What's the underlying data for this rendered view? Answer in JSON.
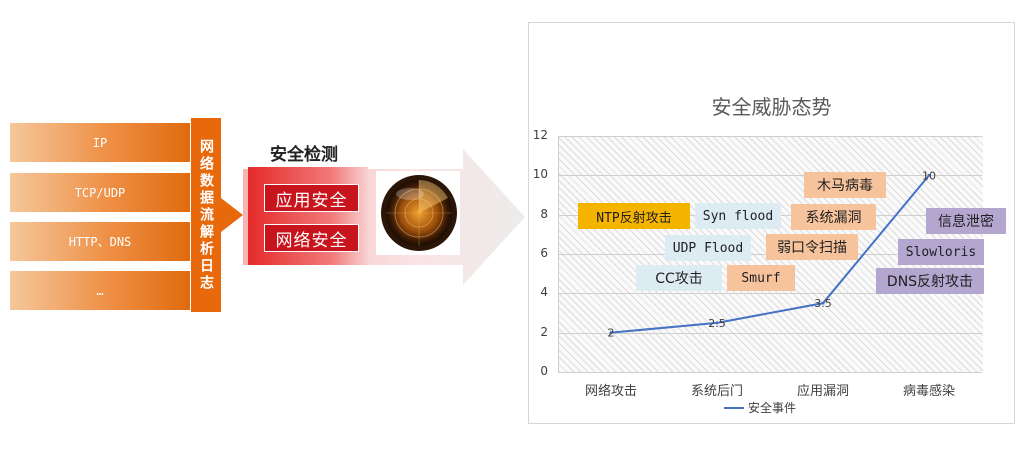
{
  "left": {
    "stack_items": [
      "IP",
      "TCP/UDP",
      "HTTP、DNS",
      "…"
    ],
    "log_label": "网络数据流解析日志"
  },
  "detection": {
    "title": "安全检测",
    "tags": [
      "应用安全",
      "网络安全"
    ]
  },
  "chart_data": {
    "type": "line",
    "title": "安全威胁态势",
    "categories": [
      "网络攻击",
      "系统后门",
      "应用漏洞",
      "病毒感染"
    ],
    "series": [
      {
        "name": "安全事件",
        "values": [
          2,
          2.5,
          3.5,
          10
        ],
        "color": "#4472c4"
      }
    ],
    "data_labels": [
      "2",
      "2.5",
      "3.5",
      "10"
    ],
    "ylim": [
      0,
      12
    ],
    "yticks": [
      "0",
      "2",
      "4",
      "6",
      "8",
      "10",
      "12"
    ],
    "grid": true,
    "legend": "bottom"
  },
  "threat_labels": [
    {
      "id": "ntp",
      "text": "NTP反射攻击",
      "color": "yellow"
    },
    {
      "id": "syn",
      "text": "Syn flood",
      "color": "blue"
    },
    {
      "id": "udp",
      "text": "UDP Flood",
      "color": "blue"
    },
    {
      "id": "cc",
      "text": "CC攻击",
      "color": "blue"
    },
    {
      "id": "smurf",
      "text": "Smurf",
      "color": "orange"
    },
    {
      "id": "weakpw",
      "text": "弱口令扫描",
      "color": "orange"
    },
    {
      "id": "vuln",
      "text": "系统漏洞",
      "color": "orange"
    },
    {
      "id": "trojan",
      "text": "木马病毒",
      "color": "orange"
    },
    {
      "id": "leak",
      "text": "信息泄密",
      "color": "purple"
    },
    {
      "id": "slowloris",
      "text": "Slowloris",
      "color": "purple"
    },
    {
      "id": "dns",
      "text": "DNS反射攻击",
      "color": "purple"
    }
  ]
}
